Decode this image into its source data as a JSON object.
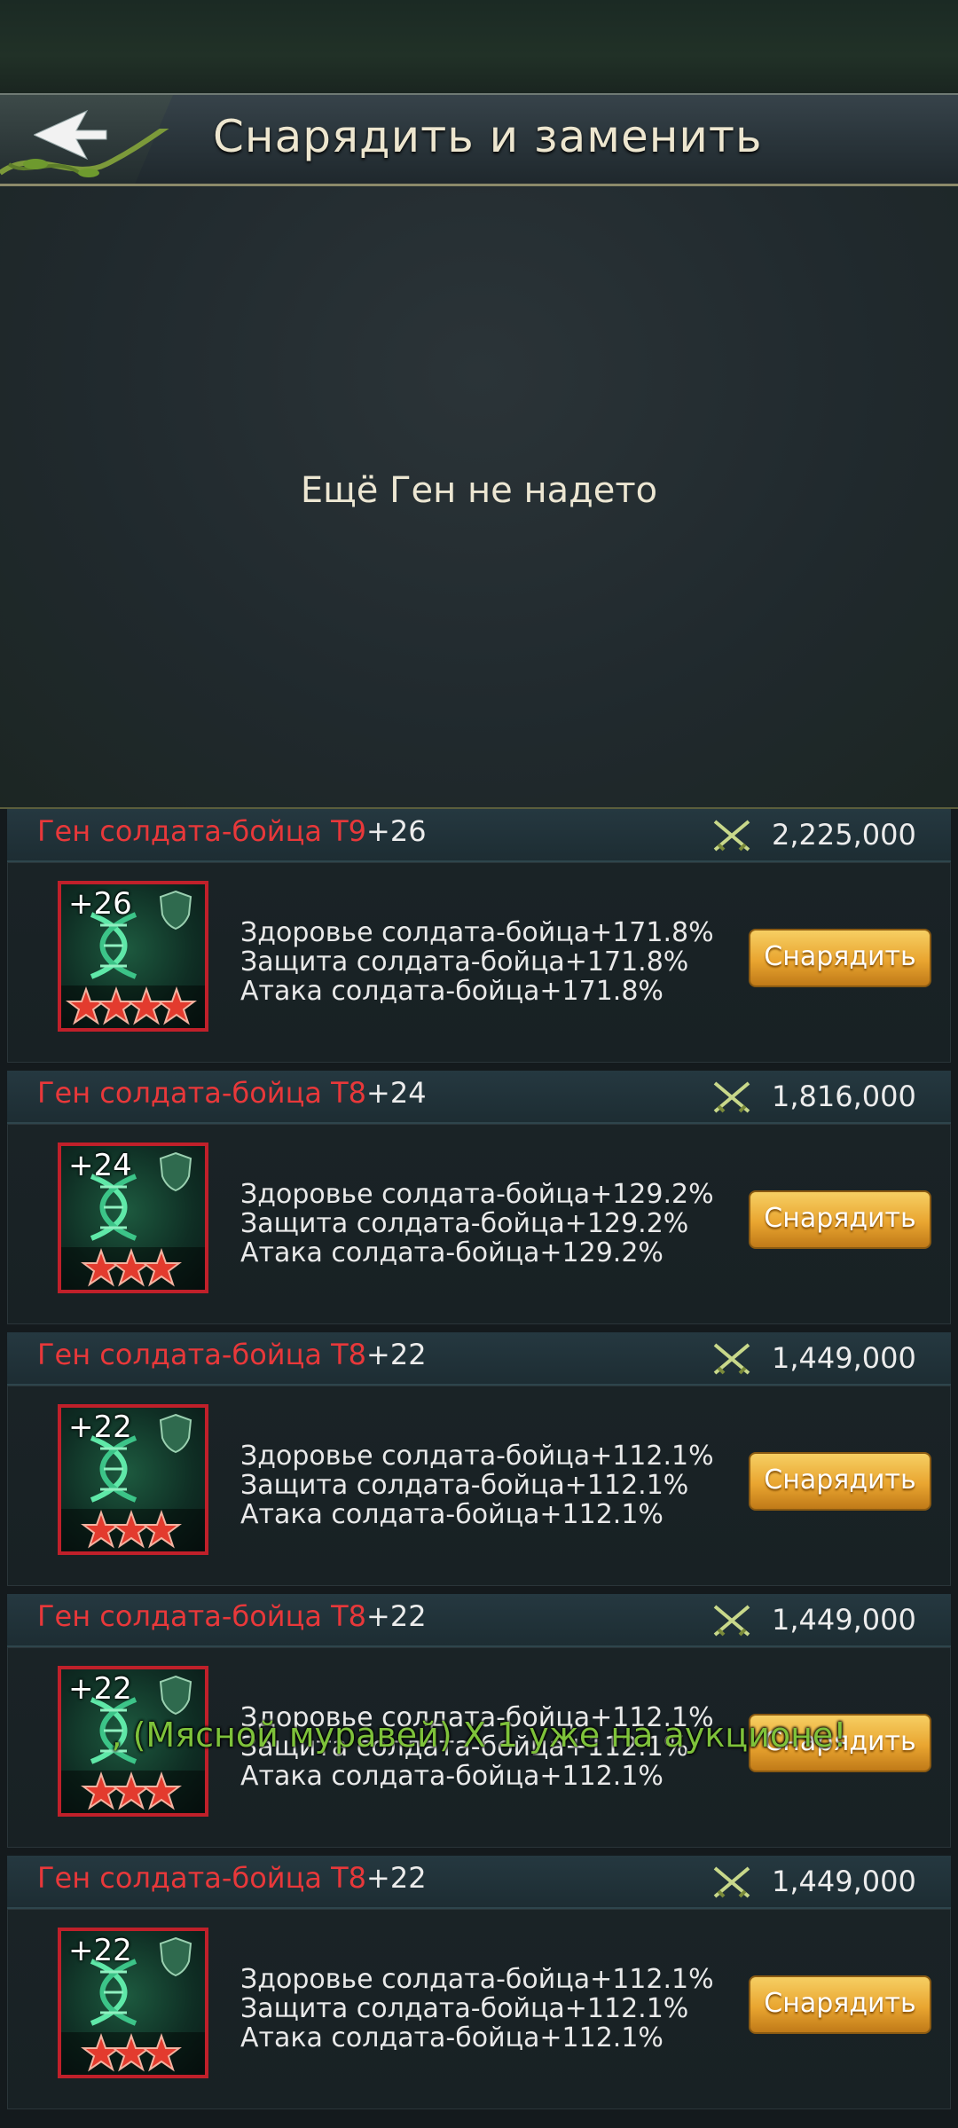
{
  "header": {
    "title": "Снарядить и заменить"
  },
  "empty_state": {
    "message": "Ещё Ген не надето"
  },
  "genes": [
    {
      "name": "Ген солдата-бойца T9",
      "level": "+26",
      "power": "2,225,000",
      "badge": "+26",
      "stars": 4,
      "stats": [
        "Здоровье солдата-бойца+171.8%",
        "Защита солдата-бойца+171.8%",
        "Атака солдата-бойца+171.8%"
      ],
      "button": "Снарядить"
    },
    {
      "name": "Ген солдата-бойца T8",
      "level": "+24",
      "power": "1,816,000",
      "badge": "+24",
      "stars": 3,
      "stats": [
        "Здоровье солдата-бойца+129.2%",
        "Защита солдата-бойца+129.2%",
        "Атака солдата-бойца+129.2%"
      ],
      "button": "Снарядить"
    },
    {
      "name": "Ген солдата-бойца T8",
      "level": "+22",
      "power": "1,449,000",
      "badge": "+22",
      "stars": 3,
      "stats": [
        "Здоровье солдата-бойца+112.1%",
        "Защита солдата-бойца+112.1%",
        "Атака солдата-бойца+112.1%"
      ],
      "button": "Снарядить"
    },
    {
      "name": "Ген солдата-бойца T8",
      "level": "+22",
      "power": "1,449,000",
      "badge": "+22",
      "stars": 3,
      "stats": [
        "Здоровье солдата-бойца+112.1%",
        "Защита солдата-бойца+112.1%",
        "Атака солдата-бойца+112.1%"
      ],
      "button": "Снарядить"
    },
    {
      "name": "Ген солдата-бойца T8",
      "level": "+22",
      "power": "1,449,000",
      "badge": "+22",
      "stars": 3,
      "stats": [
        "Здоровье солдата-бойца+112.1%",
        "Защита солдата-бойца+112.1%",
        "Атака солдата-бойца+112.1%"
      ],
      "button": "Снарядить"
    }
  ],
  "toast": {
    "message": ", (Мясной муравей) X 1 уже на аукционе!"
  },
  "colors": {
    "gene_name": "#e8383a",
    "button_gold": "#e9a530",
    "toast_green": "#7ec23a",
    "icon_border": "#c0202a"
  },
  "icons": {
    "back": "back-arrow-icon",
    "power": "crossed-swords-icon",
    "gene": "dna-helix-icon",
    "shield": "shield-icon",
    "star": "star-icon"
  }
}
